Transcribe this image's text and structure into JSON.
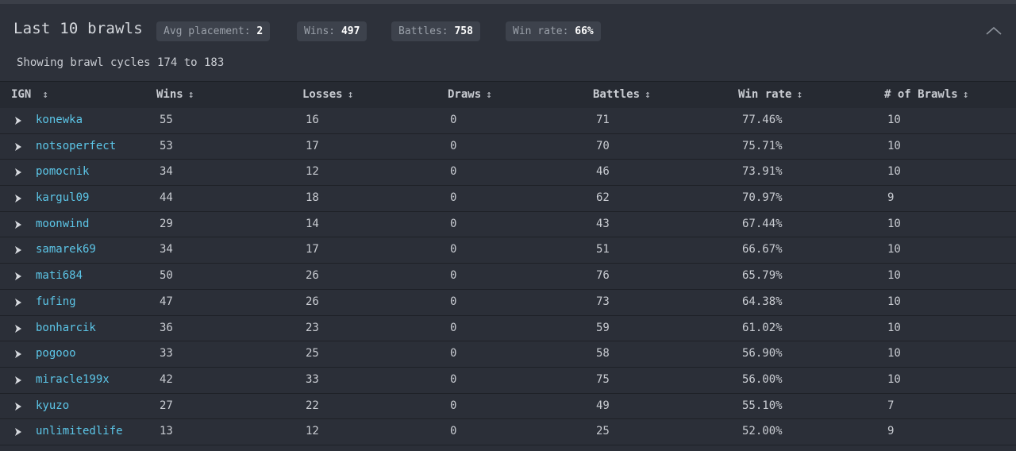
{
  "header": {
    "title": "Last 10 brawls",
    "badges": [
      {
        "label": "Avg placement:",
        "value": "2"
      },
      {
        "label": "Wins:",
        "value": "497"
      },
      {
        "label": "Battles:",
        "value": "758"
      },
      {
        "label": "Win rate:",
        "value": "66%"
      }
    ],
    "subtitle": "Showing brawl cycles 174 to 183",
    "collapse_icon": "chevron-up-icon"
  },
  "table": {
    "columns": [
      {
        "label": "IGN",
        "sort_icon": "↕"
      },
      {
        "label": "Wins",
        "sort_icon": "↕"
      },
      {
        "label": "Losses",
        "sort_icon": "↕"
      },
      {
        "label": "Draws",
        "sort_icon": "↕"
      },
      {
        "label": "Battles",
        "sort_icon": "↕"
      },
      {
        "label": "Win rate",
        "sort_icon": "↕"
      },
      {
        "label": "# of Brawls",
        "sort_icon": "↕"
      }
    ],
    "rows": [
      {
        "ign": "konewka",
        "wins": "55",
        "losses": "16",
        "draws": "0",
        "battles": "71",
        "win_rate": "77.46%",
        "brawls": "10"
      },
      {
        "ign": "notsoperfect",
        "wins": "53",
        "losses": "17",
        "draws": "0",
        "battles": "70",
        "win_rate": "75.71%",
        "brawls": "10"
      },
      {
        "ign": "pomocnik",
        "wins": "34",
        "losses": "12",
        "draws": "0",
        "battles": "46",
        "win_rate": "73.91%",
        "brawls": "10"
      },
      {
        "ign": "kargul09",
        "wins": "44",
        "losses": "18",
        "draws": "0",
        "battles": "62",
        "win_rate": "70.97%",
        "brawls": "9"
      },
      {
        "ign": "moonwind",
        "wins": "29",
        "losses": "14",
        "draws": "0",
        "battles": "43",
        "win_rate": "67.44%",
        "brawls": "10"
      },
      {
        "ign": "samarek69",
        "wins": "34",
        "losses": "17",
        "draws": "0",
        "battles": "51",
        "win_rate": "66.67%",
        "brawls": "10"
      },
      {
        "ign": "mati684",
        "wins": "50",
        "losses": "26",
        "draws": "0",
        "battles": "76",
        "win_rate": "65.79%",
        "brawls": "10"
      },
      {
        "ign": "fufing",
        "wins": "47",
        "losses": "26",
        "draws": "0",
        "battles": "73",
        "win_rate": "64.38%",
        "brawls": "10"
      },
      {
        "ign": "bonharcik",
        "wins": "36",
        "losses": "23",
        "draws": "0",
        "battles": "59",
        "win_rate": "61.02%",
        "brawls": "10"
      },
      {
        "ign": "pogooo",
        "wins": "33",
        "losses": "25",
        "draws": "0",
        "battles": "58",
        "win_rate": "56.90%",
        "brawls": "10"
      },
      {
        "ign": "miracle199x",
        "wins": "42",
        "losses": "33",
        "draws": "0",
        "battles": "75",
        "win_rate": "56.00%",
        "brawls": "10"
      },
      {
        "ign": "kyuzo",
        "wins": "27",
        "losses": "22",
        "draws": "0",
        "battles": "49",
        "win_rate": "55.10%",
        "brawls": "7"
      },
      {
        "ign": "unlimitedlife",
        "wins": "13",
        "losses": "12",
        "draws": "0",
        "battles": "25",
        "win_rate": "52.00%",
        "brawls": "9"
      }
    ],
    "expand_icon": "chevron-right-icon"
  },
  "colors": {
    "background": "#2b2f38",
    "header_row": "#262a32",
    "link": "#5cc6e8",
    "badge_bg": "#3d424c"
  }
}
